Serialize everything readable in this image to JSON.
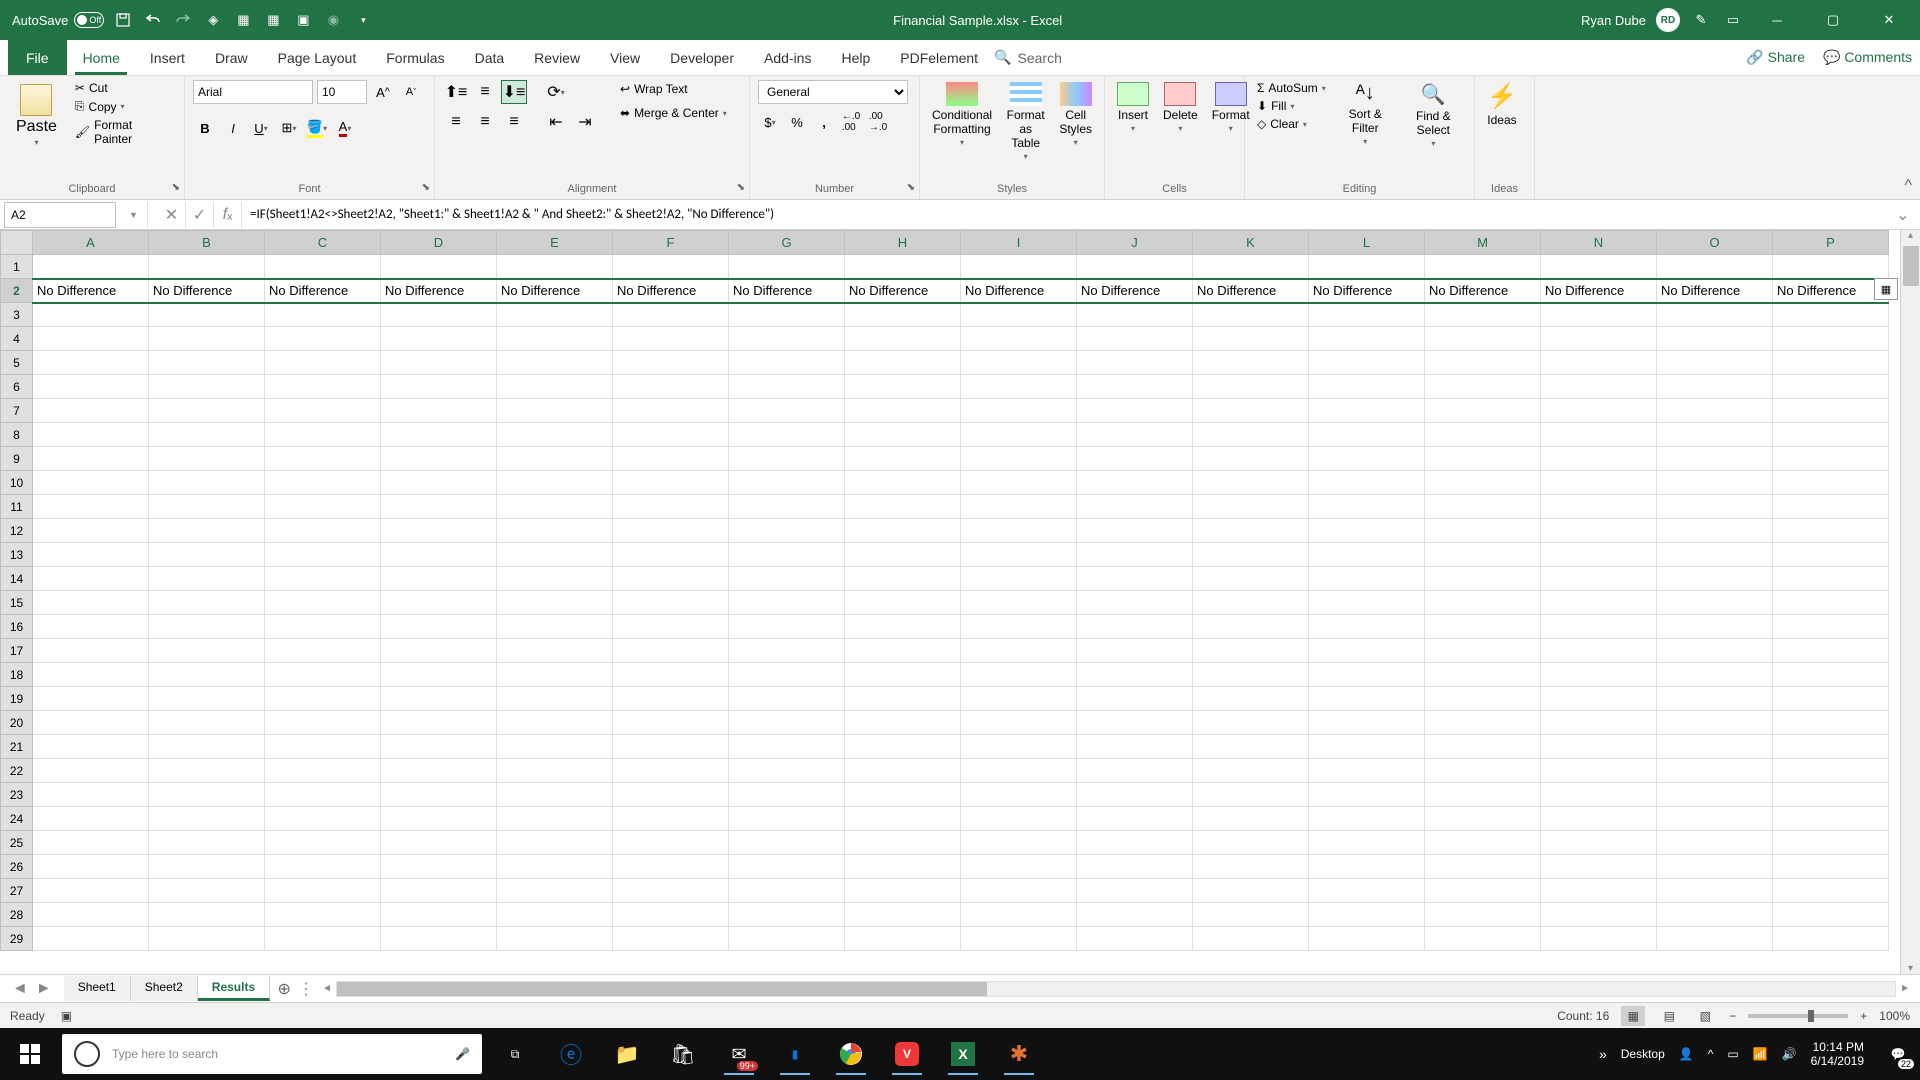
{
  "title_bar": {
    "autosave_label": "AutoSave",
    "autosave_state": "Off",
    "doc_title": "Financial Sample.xlsx - Excel",
    "user_name": "Ryan Dube",
    "user_initials": "RD"
  },
  "ribbon_tabs": {
    "tabs": [
      "File",
      "Home",
      "Insert",
      "Draw",
      "Page Layout",
      "Formulas",
      "Data",
      "Review",
      "View",
      "Developer",
      "Add-ins",
      "Help",
      "PDFelement"
    ],
    "active_index": 1,
    "search_placeholder": "Search",
    "share_label": "Share",
    "comments_label": "Comments"
  },
  "ribbon": {
    "clipboard": {
      "label": "Clipboard",
      "paste": "Paste",
      "cut": "Cut",
      "copy": "Copy",
      "painter": "Format Painter"
    },
    "font": {
      "label": "Font",
      "name": "Arial",
      "size": "10"
    },
    "alignment": {
      "label": "Alignment",
      "wrap": "Wrap Text",
      "merge": "Merge & Center"
    },
    "number": {
      "label": "Number",
      "format": "General"
    },
    "styles": {
      "label": "Styles",
      "conditional": "Conditional Formatting",
      "table": "Format as Table",
      "cell": "Cell Styles"
    },
    "cells": {
      "label": "Cells",
      "insert": "Insert",
      "delete": "Delete",
      "format": "Format"
    },
    "editing": {
      "label": "Editing",
      "autosum": "AutoSum",
      "fill": "Fill",
      "clear": "Clear",
      "sort": "Sort & Filter",
      "find": "Find & Select"
    },
    "ideas": {
      "label": "Ideas",
      "ideas_btn": "Ideas"
    }
  },
  "formula_bar": {
    "cell_ref": "A2",
    "formula": "=IF(Sheet1!A2<>Sheet2!A2, \"Sheet1:\" & Sheet1!A2 & \" And Sheet2:\" & Sheet2!A2, \"No Difference\")"
  },
  "grid": {
    "columns": [
      "A",
      "B",
      "C",
      "D",
      "E",
      "F",
      "G",
      "H",
      "I",
      "J",
      "K",
      "L",
      "M",
      "N",
      "O",
      "P"
    ],
    "row_count": 29,
    "selected_row": 2,
    "data_row_values": [
      "No Difference",
      "No Difference",
      "No Difference",
      "No Difference",
      "No Difference",
      "No Difference",
      "No Difference",
      "No Difference",
      "No Difference",
      "No Difference",
      "No Difference",
      "No Difference",
      "No Difference",
      "No Difference",
      "No Difference",
      "No Difference"
    ]
  },
  "sheets": {
    "tabs": [
      "Sheet1",
      "Sheet2",
      "Results"
    ],
    "active_index": 2
  },
  "status": {
    "ready": "Ready",
    "count": "Count: 16",
    "zoom": "100%"
  },
  "taskbar": {
    "search_placeholder": "Type here to search",
    "desktop_label": "Desktop",
    "time": "10:14 PM",
    "date": "6/14/2019",
    "mail_badge": "99+",
    "notif_count": "22"
  },
  "colors": {
    "accent": "#217346"
  }
}
